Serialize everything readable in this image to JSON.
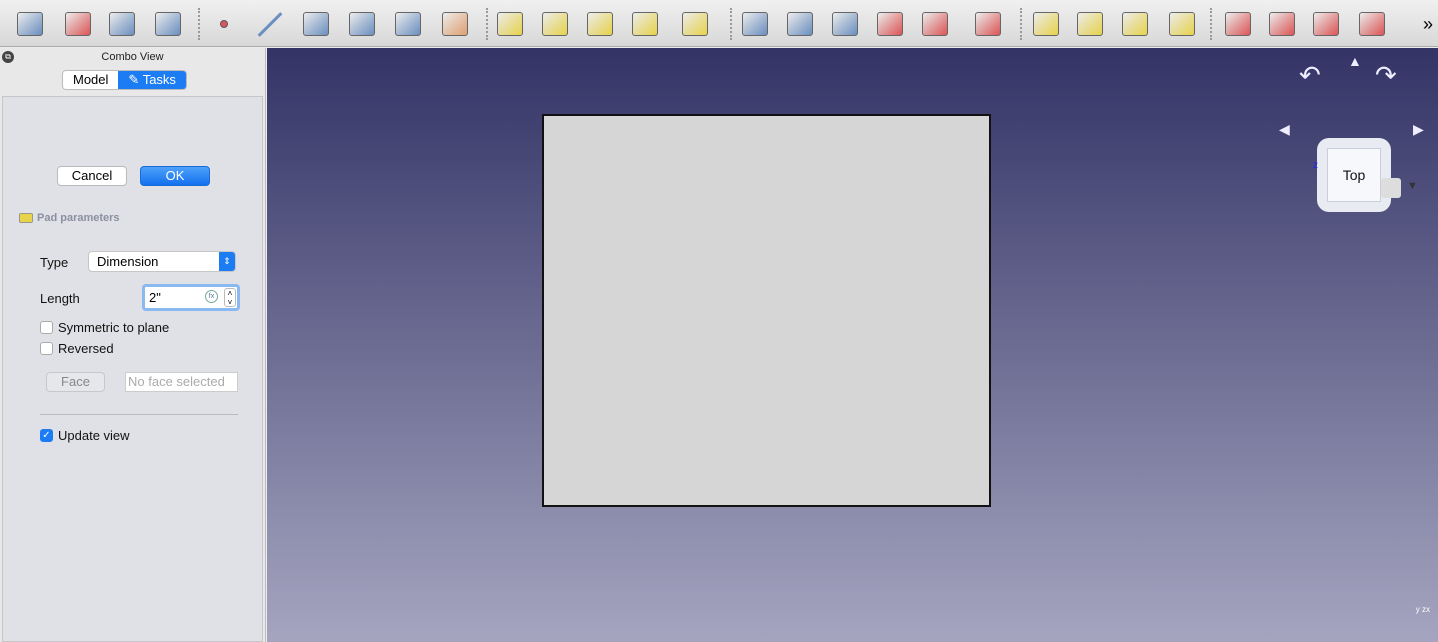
{
  "toolbar": {
    "icons": [
      {
        "name": "part-design-body-icon",
        "color": "#6a8fc0"
      },
      {
        "name": "create-sketch-icon",
        "color": "#d55"
      },
      {
        "name": "map-sketch-icon",
        "color": "#6a8fc0"
      },
      {
        "name": "validate-sketch-icon",
        "color": "#6a8fc0"
      },
      {
        "name": "datum-point-icon",
        "color": "#d55"
      },
      {
        "name": "datum-line-icon",
        "color": "#6a8fc0"
      },
      {
        "name": "datum-plane-icon",
        "color": "#6a8fc0"
      },
      {
        "name": "local-coordinate-system-icon",
        "color": "#6a8fc0"
      },
      {
        "name": "shape-binder-icon",
        "color": "#6a8fc0"
      },
      {
        "name": "clone-icon",
        "color": "#e0a070"
      },
      {
        "name": "pad-icon",
        "color": "#e8d34a"
      },
      {
        "name": "revolution-icon",
        "color": "#e8d34a"
      },
      {
        "name": "additive-loft-icon",
        "color": "#e8d34a"
      },
      {
        "name": "additive-pipe-icon",
        "color": "#e8d34a"
      },
      {
        "name": "additive-primitive-icon",
        "color": "#e8d34a"
      },
      {
        "name": "pocket-icon",
        "color": "#6a8fc0"
      },
      {
        "name": "hole-icon",
        "color": "#6a8fc0"
      },
      {
        "name": "groove-icon",
        "color": "#6a8fc0"
      },
      {
        "name": "subtractive-loft-icon",
        "color": "#d55"
      },
      {
        "name": "subtractive-pipe-icon",
        "color": "#d55"
      },
      {
        "name": "subtractive-primitive-icon",
        "color": "#d55"
      },
      {
        "name": "mirrored-icon",
        "color": "#e8d34a"
      },
      {
        "name": "linear-pattern-icon",
        "color": "#e8d34a"
      },
      {
        "name": "polar-pattern-icon",
        "color": "#e8d34a"
      },
      {
        "name": "multi-transform-icon",
        "color": "#e8d34a"
      },
      {
        "name": "fillet-icon",
        "color": "#d55"
      },
      {
        "name": "chamfer-icon",
        "color": "#d55"
      },
      {
        "name": "draft-icon",
        "color": "#d55"
      },
      {
        "name": "thickness-icon",
        "color": "#d55"
      }
    ],
    "overflow": "»"
  },
  "panel": {
    "title": "Combo View",
    "tabs": [
      {
        "label": "Model"
      },
      {
        "label": "✎ Tasks"
      }
    ],
    "active_tab": "Tasks",
    "cancel": "Cancel",
    "ok": "OK",
    "section": "Pad parameters",
    "type_label": "Type",
    "type_value": "Dimension",
    "length_label": "Length",
    "length_value": "2\"",
    "symmetric_label": "Symmetric to plane",
    "symmetric_checked": false,
    "reversed_label": "Reversed",
    "reversed_checked": false,
    "face_button": "Face",
    "face_placeholder": "No face selected",
    "update_label": "Update view",
    "update_checked": true
  },
  "viewport": {
    "nav_face": "Top",
    "axis_z": "z",
    "axis_x": "x",
    "axis_y": "y",
    "bg_top": "#333366",
    "bg_bottom": "#a5a5c0",
    "shape_fill": "#d6d6d6"
  }
}
